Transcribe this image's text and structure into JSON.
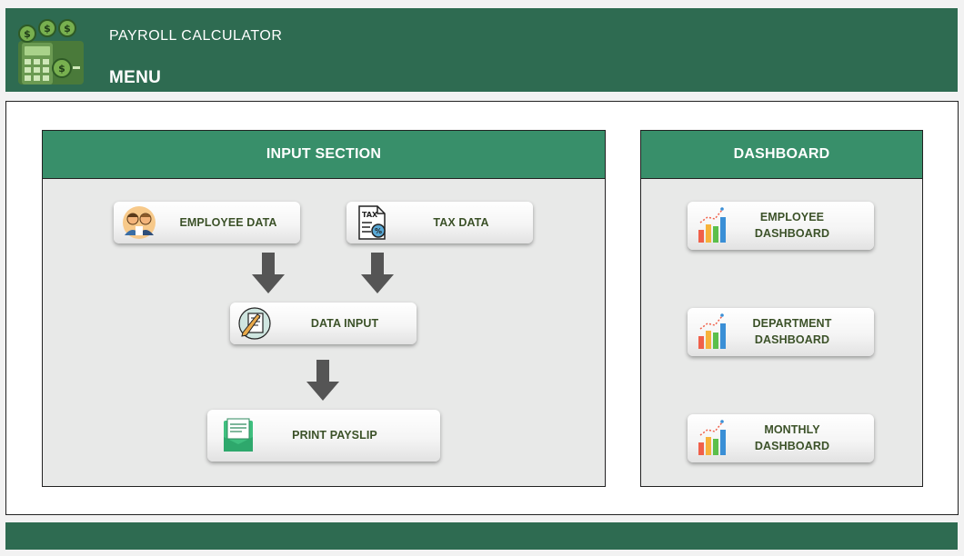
{
  "header": {
    "app_title": "PAYROLL CALCULATOR",
    "page_title": "MENU"
  },
  "input_section": {
    "title": "INPUT SECTION",
    "buttons": {
      "employee_data": "EMPLOYEE DATA",
      "tax_data": "TAX DATA",
      "data_input": "DATA INPUT",
      "print_payslip": "PRINT PAYSLIP"
    }
  },
  "dashboard": {
    "title": "DASHBOARD",
    "buttons": {
      "employee_line1": "EMPLOYEE",
      "employee_line2": "DASHBOARD",
      "department_line1": "DEPARTMENT",
      "department_line2": "DASHBOARD",
      "monthly_line1": "MONTHLY",
      "monthly_line2": "DASHBOARD"
    }
  },
  "icons": {
    "logo": "payroll-calculator-logo",
    "employee": "employees-icon",
    "tax": "tax-document-icon",
    "data_input": "edit-document-icon",
    "payslip": "payslip-icon",
    "dashboard": "bar-chart-icon"
  },
  "colors": {
    "header_bg": "#2e6b51",
    "panel_header_bg": "#388f6a",
    "panel_bg": "#e8e9e8",
    "button_text": "#3b5128",
    "arrow": "#555555"
  }
}
